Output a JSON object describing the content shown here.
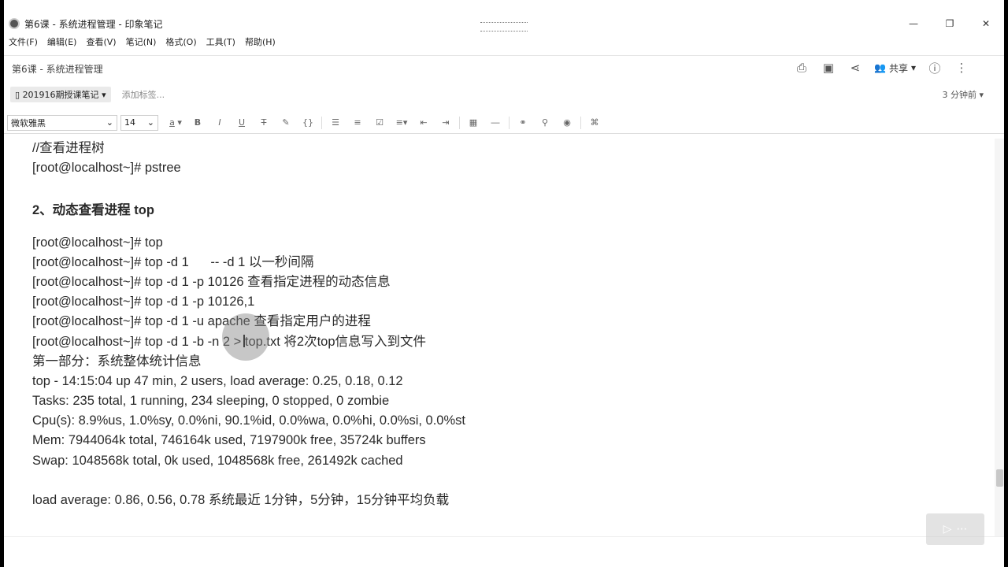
{
  "window": {
    "title": "第6课 - 系统进程管理 - 印象笔记",
    "controls": [
      "—",
      "❐",
      "✕"
    ]
  },
  "menu": [
    "文件(F)",
    "编辑(E)",
    "查看(V)",
    "笔记(N)",
    "格式(O)",
    "工具(T)",
    "帮助(H)"
  ],
  "note": {
    "title": "第6课 - 系统进程管理",
    "share_label": "共享",
    "notebook": "201916期授课笔记",
    "tag_placeholder": "添加标签...",
    "updated": "3 分钟前"
  },
  "toolbar": {
    "font": "微软雅黑",
    "size": "14"
  },
  "content": {
    "lines": [
      "//查看进程树",
      "[root@localhost~]# pstree",
      "2、动态查看进程 top",
      "[root@localhost~]# top",
      "[root@localhost~]# top -d 1      -- -d 1 以一秒间隔",
      "[root@localhost~]# top -d 1 -p 10126 查看指定进程的动态信息",
      "[root@localhost~]# top -d 1 -p 10126,1",
      "[root@localhost~]# top -d 1 -u apache 查看指定用户的进程",
      "[root@localhost~]# top -d 1 -b -n 2 > top.txt 将2次top信息写入到文件",
      "第一部分：系统整体统计信息",
      "top - 14:15:04 up 47 min, 2 users, load average: 0.25, 0.18, 0.12",
      "Tasks: 235 total, 1 running, 234 sleeping, 0 stopped, 0 zombie",
      "Cpu(s): 8.9%us, 1.0%sy, 0.0%ni, 90.1%id, 0.0%wa, 0.0%hi, 0.0%si, 0.0%st",
      "Mem: 7944064k total, 746164k used, 7197900k free, 35724k buffers",
      "Swap: 1048568k total, 0k used, 1048568k free, 261492k cached",
      "load average: 0.86, 0.56, 0.78 系统最近 1分钟，5分钟，15分钟平均负载"
    ]
  }
}
